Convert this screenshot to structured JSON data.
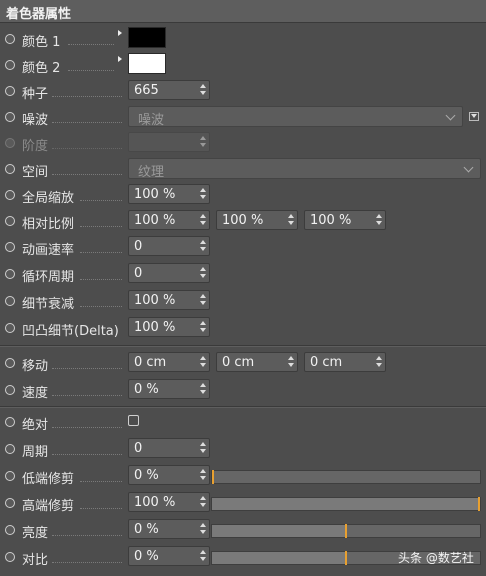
{
  "panel": {
    "title": "着色器属性"
  },
  "rows": {
    "color1": {
      "label": "颜色 1",
      "color": "#000000"
    },
    "color2": {
      "label": "颜色 2",
      "color": "#ffffff"
    },
    "seed": {
      "label": "种子",
      "value": "665"
    },
    "noise": {
      "label": "噪波",
      "value": "噪波"
    },
    "octaves": {
      "label": "阶度",
      "value": ""
    },
    "space": {
      "label": "空间",
      "value": "纹理"
    },
    "global_scale": {
      "label": "全局缩放",
      "value": "100 %"
    },
    "relative_scale": {
      "label": "相对比例",
      "values": [
        "100 %",
        "100 %",
        "100 %"
      ]
    },
    "anim_speed": {
      "label": "动画速率",
      "value": "0"
    },
    "loop_period": {
      "label": "循环周期",
      "value": "0"
    },
    "detail_atten": {
      "label": "细节衰减",
      "value": "100 %"
    },
    "delta": {
      "label": "凹凸细节(Delta)",
      "value": "100 %"
    },
    "move": {
      "label": "移动",
      "values": [
        "0 cm",
        "0 cm",
        "0 cm"
      ]
    },
    "velocity": {
      "label": "速度",
      "value": "0 %"
    },
    "absolute": {
      "label": "绝对",
      "checked": false
    },
    "cycles": {
      "label": "周期",
      "value": "0"
    },
    "low_clip": {
      "label": "低端修剪",
      "value": "0 %",
      "level": 0.0
    },
    "high_clip": {
      "label": "高端修剪",
      "value": "100 %",
      "level": 1.0
    },
    "brightness": {
      "label": "亮度",
      "value": "0 %",
      "level": 0.5
    },
    "contrast": {
      "label": "对比",
      "value": "0 %",
      "level": 0.5
    }
  },
  "watermark": {
    "text": "头条 @数艺社"
  },
  "colors": {
    "accent_marker": "#e8a030"
  }
}
